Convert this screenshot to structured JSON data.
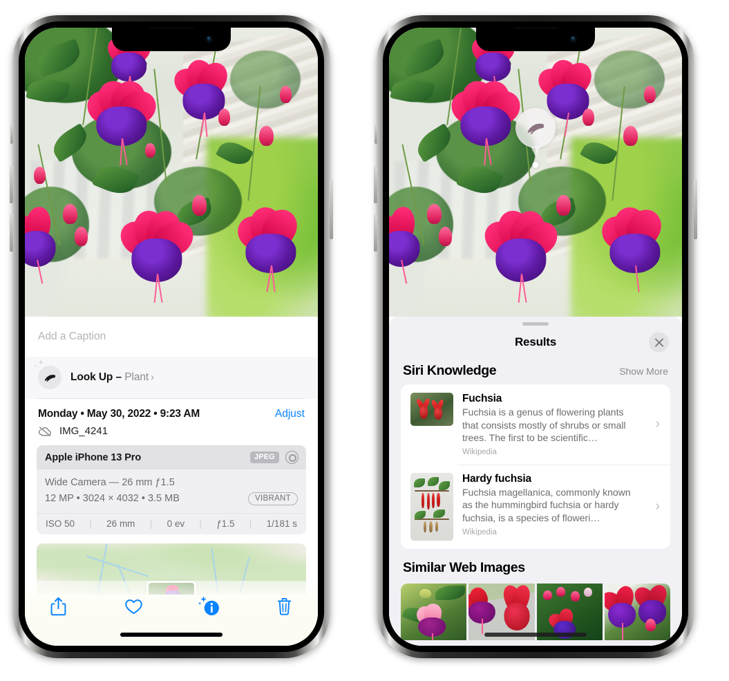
{
  "left_phone": {
    "caption_placeholder": "Add a Caption",
    "lookup": {
      "label": "Look Up",
      "dash": "–",
      "subject": "Plant",
      "chevron": "›",
      "icon": "leaf-icon"
    },
    "meta": {
      "date": "Monday • May 30, 2022 • 9:23 AM",
      "adjust_label": "Adjust",
      "filename": "IMG_4241",
      "cloud_icon": "icloud-slash-icon"
    },
    "exif": {
      "device": "Apple iPhone 13 Pro",
      "format_badge": "JPEG",
      "aperture_icon": "aperture-icon",
      "lens_line": "Wide Camera — 26 mm ƒ1.5",
      "specs_line": "12 MP • 3024 × 4032 • 3.5 MB",
      "style_badge": "VIBRANT",
      "stats": [
        "ISO 50",
        "26 mm",
        "0 ev",
        "ƒ1.5",
        "1/181 s"
      ]
    },
    "toolbar": [
      {
        "name": "share-button",
        "icon": "share-icon"
      },
      {
        "name": "favorite-button",
        "icon": "heart-icon"
      },
      {
        "name": "info-button",
        "icon": "info-sparkle-icon"
      },
      {
        "name": "delete-button",
        "icon": "trash-icon"
      }
    ]
  },
  "right_phone": {
    "visual_lookup_badge": {
      "icon": "leaf-icon"
    },
    "results": {
      "title": "Results",
      "close_icon": "close-icon",
      "siri_knowledge": {
        "title": "Siri Knowledge",
        "show_more": "Show More",
        "items": [
          {
            "title": "Fuchsia",
            "description": "Fuchsia is a genus of flowering plants that consists mostly of shrubs or small trees. The first to be scientific…",
            "source": "Wikipedia",
            "chevron": "›"
          },
          {
            "title": "Hardy fuchsia",
            "description": "Fuchsia magellanica, commonly known as the hummingbird fuchsia or hardy fuchsia, is a species of floweri…",
            "source": "Wikipedia",
            "chevron": "›"
          }
        ]
      },
      "similar_web_images": {
        "title": "Similar Web Images",
        "count": 4
      }
    }
  },
  "colors": {
    "accent_blue": "#0a84ff",
    "sheet_grey": "#f1f1f5",
    "exif_grey": "#f0f0f2",
    "text_secondary": "#6d6d72"
  }
}
